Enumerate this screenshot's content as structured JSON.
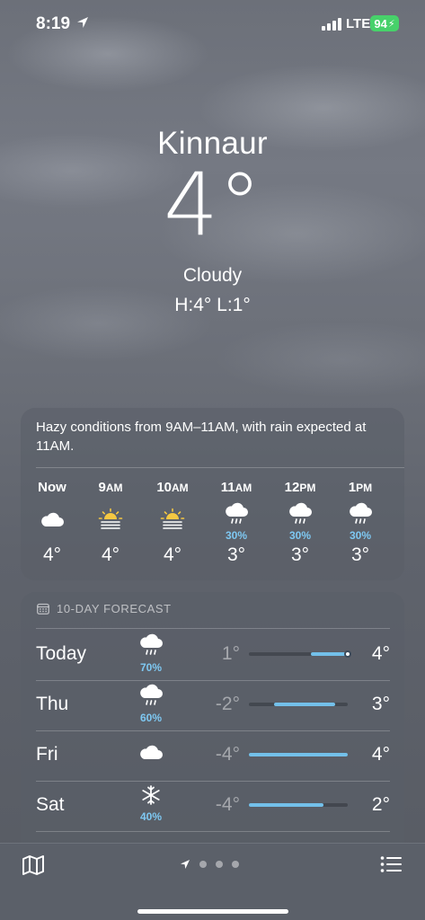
{
  "status_bar": {
    "time": "8:19",
    "network": "LTE",
    "battery": "94"
  },
  "location": {
    "city": "Kinnaur",
    "temperature": "4°",
    "condition": "Cloudy",
    "high_low": "H:4°  L:1°"
  },
  "hourly": {
    "summary": "Hazy conditions from 9AM–11AM, with rain expected at 11AM.",
    "hours": [
      {
        "label": "Now",
        "ampm": "",
        "icon": "cloud-icon",
        "pop": "",
        "temp": "4°"
      },
      {
        "label": "9",
        "ampm": "AM",
        "icon": "sun-haze-icon",
        "pop": "",
        "temp": "4°"
      },
      {
        "label": "10",
        "ampm": "AM",
        "icon": "sun-haze-icon",
        "pop": "",
        "temp": "4°"
      },
      {
        "label": "11",
        "ampm": "AM",
        "icon": "cloud-rain-icon",
        "pop": "30%",
        "temp": "3°"
      },
      {
        "label": "12",
        "ampm": "PM",
        "icon": "cloud-rain-icon",
        "pop": "30%",
        "temp": "3°"
      },
      {
        "label": "1",
        "ampm": "PM",
        "icon": "cloud-rain-icon",
        "pop": "30%",
        "temp": "3°"
      }
    ]
  },
  "forecast": {
    "title": "10-DAY FORECAST",
    "days": [
      {
        "day": "Today",
        "icon": "cloud-rain-icon",
        "pop": "70%",
        "low": "1°",
        "high": "4°",
        "current": "4°"
      },
      {
        "day": "Thu",
        "icon": "cloud-rain-icon",
        "pop": "60%",
        "low": "-2°",
        "high": "3°"
      },
      {
        "day": "Fri",
        "icon": "cloud-icon",
        "pop": "",
        "low": "-4°",
        "high": "4°"
      },
      {
        "day": "Sat",
        "icon": "snowflake-icon",
        "pop": "40%",
        "low": "-4°",
        "high": "2°"
      }
    ]
  },
  "colors": {
    "precipitation": "#7ec8f2",
    "range_bar": "#73c0ea",
    "sun": "#f5c842",
    "battery": "#47d16a"
  },
  "pager": {
    "pages": 4,
    "current": 0
  }
}
